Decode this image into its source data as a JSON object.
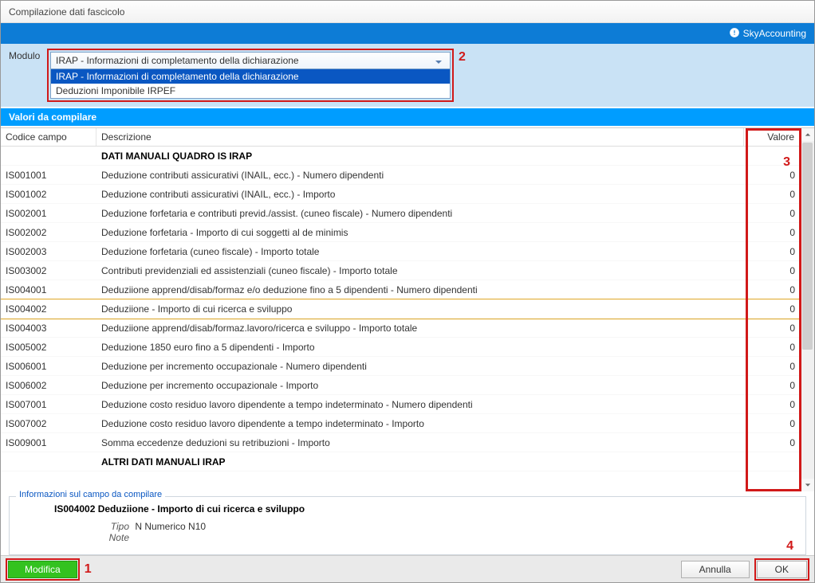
{
  "window": {
    "title": "Compilazione dati fascicolo"
  },
  "brand": {
    "name": "SkyAccounting"
  },
  "modulo": {
    "label": "Modulo",
    "selected": "IRAP - Informazioni di completamento della dichiarazione",
    "options": [
      "IRAP - Informazioni di completamento della dichiarazione",
      "Deduzioni Imponibile IRPEF"
    ]
  },
  "annot": {
    "a1": "1",
    "a2": "2",
    "a3": "3",
    "a4": "4"
  },
  "valori_header": "Valori da compilare",
  "columns": {
    "code": "Codice campo",
    "desc": "Descrizione",
    "val": "Valore"
  },
  "sections": {
    "s1": "DATI MANUALI QUADRO IS IRAP",
    "s2": "ALTRI DATI MANUALI IRAP"
  },
  "rows": [
    {
      "code": "IS001001",
      "desc": "Deduzione contributi assicurativi (INAIL, ecc.) - Numero dipendenti",
      "val": "0"
    },
    {
      "code": "IS001002",
      "desc": "Deduzione contributi assicurativi (INAIL, ecc.) - Importo",
      "val": "0"
    },
    {
      "code": "IS002001",
      "desc": "Deduzione forfetaria e contributi previd./assist. (cuneo fiscale) - Numero dipendenti",
      "val": "0"
    },
    {
      "code": "IS002002",
      "desc": "Deduzione forfetaria - Importo di cui soggetti al de minimis",
      "val": "0"
    },
    {
      "code": "IS002003",
      "desc": "Deduzione forfetaria (cuneo fiscale) - Importo totale",
      "val": "0"
    },
    {
      "code": "IS003002",
      "desc": "Contributi previdenziali ed assistenziali (cuneo fiscale) - Importo totale",
      "val": "0"
    },
    {
      "code": "IS004001",
      "desc": "Deduziione apprend/disab/formaz e/o deduzione fino a 5 dipendenti - Numero dipendenti",
      "val": "0"
    },
    {
      "code": "IS004002",
      "desc": "Deduziione - Importo di cui ricerca e sviluppo",
      "val": "0",
      "selected": true
    },
    {
      "code": "IS004003",
      "desc": "Deduziione apprend/disab/formaz.lavoro/ricerca e sviluppo - Importo totale",
      "val": "0"
    },
    {
      "code": "IS005002",
      "desc": "Deduzione 1850 euro fino a 5 dipendenti - Importo",
      "val": "0"
    },
    {
      "code": "IS006001",
      "desc": "Deduzione per incremento occupazionale - Numero dipendenti",
      "val": "0"
    },
    {
      "code": "IS006002",
      "desc": "Deduzione per incremento occupazionale - Importo",
      "val": "0"
    },
    {
      "code": "IS007001",
      "desc": "Deduzione costo residuo  lavoro dipendente a tempo indeterminato - Numero dipendenti",
      "val": "0"
    },
    {
      "code": "IS007002",
      "desc": "Deduzione costo residuo  lavoro dipendente a tempo indeterminato - Importo",
      "val": "0"
    },
    {
      "code": "IS009001",
      "desc": "Somma eccedenze deduzioni su retribuzioni - Importo",
      "val": "0"
    }
  ],
  "info": {
    "legend": "Informazioni sul campo da compilare",
    "title": "IS004002  Deduziione - Importo di cui ricerca e sviluppo",
    "tipo_label": "Tipo",
    "tipo_value": "N   Numerico  N10",
    "note_label": "Note",
    "note_value": ""
  },
  "footer": {
    "modifica": "Modifica",
    "annulla": "Annulla",
    "ok": "OK"
  }
}
